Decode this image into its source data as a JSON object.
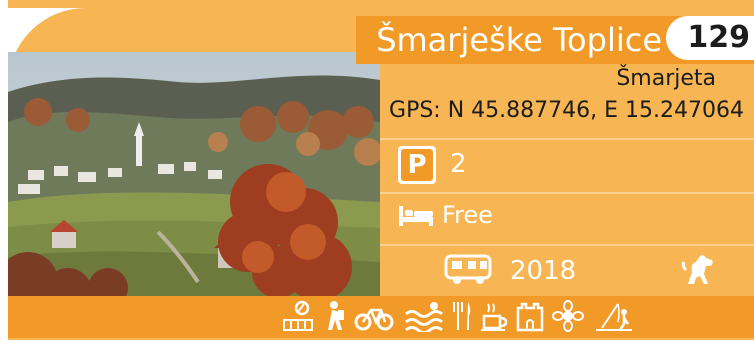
{
  "site": {
    "title": "Šmarješke Toplice",
    "number": "129",
    "city": "Šmarjeta",
    "gps": "GPS: N 45.887746, E 15.247064"
  },
  "details": {
    "parking_spaces": "2",
    "overnight": "Free",
    "year": "2018"
  },
  "icons": {
    "parking": "parking-icon",
    "overnight": "bed-icon",
    "year": "camper-icon",
    "pets": "dog-icon",
    "amenities": [
      "tennis-icon",
      "hiking-icon",
      "cycling-icon",
      "swimming-icon",
      "restaurant-icon",
      "cafe-icon",
      "castle-icon",
      "flower-icon",
      "fishing-icon"
    ]
  },
  "colors": {
    "card": "#f7b653",
    "accent": "#f29a27",
    "text_dark": "#1c1c1c",
    "text_light": "#ffffff"
  }
}
